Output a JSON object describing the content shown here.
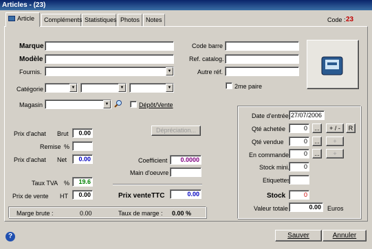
{
  "window": {
    "title": "Articles - (23)"
  },
  "tabs": [
    "Article",
    "Compléments",
    "Statistiques",
    "Photos",
    "Notes"
  ],
  "code": {
    "label": "Code :",
    "value": "23"
  },
  "left": {
    "marque": "Marque",
    "modele": "Modèle",
    "fournis": "Fournis.",
    "categorie": "Catégorie",
    "magasin": "Magasin",
    "depot": "Dépôt/Vente"
  },
  "right": {
    "code_barre": "Code barre",
    "ref_catalog": "Ref. catalog.",
    "autre_ref": "Autre réf.",
    "deuxieme_paire": "2me paire"
  },
  "prices": {
    "prix_achat_brut": "Prix d'achat",
    "brut": "Brut",
    "prix_achat_brut_val": "0.00",
    "remise": "Remise",
    "pct": "%",
    "prix_achat_net": "Prix d'achat",
    "net": "Net",
    "prix_achat_net_val": "0.00",
    "depreciation": "Dépréciation...",
    "coefficient": "Coefficient",
    "coefficient_val": "0.0000",
    "main_oeuvre": "Main d'oeuvre",
    "taux_tva": "Taux TVA",
    "taux_tva_pct": "%",
    "taux_tva_val": "19.6",
    "prix_vente_ht": "Prix de vente",
    "ht": "HT",
    "prix_vente_ht_val": "0.00",
    "prix_vente_ttc": "Prix vente",
    "ttc": "TTC",
    "prix_vente_ttc_val": "0.00"
  },
  "marge": {
    "marge_brute_label": "Marge brute :",
    "marge_brute_val": "0.00",
    "taux_label": "Taux de marge :",
    "taux_val": "0.00 %"
  },
  "stock": {
    "date_entree": "Date d'entrée",
    "date_entree_val": "27/07/2006",
    "qte_achetee": "Qté achetée",
    "qte_achetee_val": "0",
    "qte_vendue": "Qté vendue",
    "qte_vendue_val": "0",
    "en_commande": "En commande",
    "en_commande_val": "0",
    "stock_mini": "Stock mini.",
    "stock_mini_val": "0",
    "etiquettes": "Etiquettes",
    "stock": "Stock",
    "stock_val": "0",
    "valeur_totale": "Valeur totale",
    "valeur_totale_val": "0.00",
    "euros": "Euros",
    "ellipsis": "...",
    "plus_minus": "+ / -",
    "plus": "+",
    "r": "R"
  },
  "footer": {
    "sauver": "Sauver",
    "annuler": "Annuler"
  },
  "colors": {
    "title_bg": "#0a246a",
    "code_red": "#c00000",
    "coef_purple": "#800080",
    "tva_green": "#008000",
    "stock_red": "#cc0000",
    "blue_val": "#0000c0"
  }
}
